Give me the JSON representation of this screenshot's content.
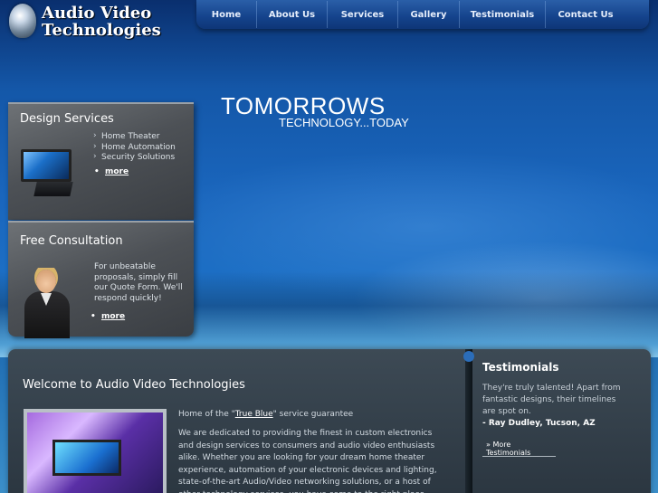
{
  "logo": {
    "line1": "Audio Video",
    "line2": "Technologies"
  },
  "nav": {
    "items": [
      {
        "label": "Home"
      },
      {
        "label": "About Us"
      },
      {
        "label": "Services"
      },
      {
        "label": "Gallery"
      },
      {
        "label": "Testimonials"
      },
      {
        "label": "Contact Us"
      }
    ]
  },
  "hero": {
    "line1": "TOMORROWS",
    "line2": "TECHNOLOGY...TODAY"
  },
  "design_services": {
    "title": "Design Services",
    "items": [
      "Home Theater",
      "Home Automation",
      "Security Solutions"
    ],
    "more": "more"
  },
  "free_consultation": {
    "title": "Free Consultation",
    "text": "For unbeatable proposals, simply fill our Quote Form. We'll respond quickly!",
    "more": "more"
  },
  "welcome": {
    "title": "Welcome to Audio Video Technologies",
    "home_prefix": "Home of the \"",
    "home_link": "True Blue",
    "home_suffix": "\" service guarantee",
    "paragraph": "We are dedicated to providing the finest in custom electronics and design services to consumers and audio video enthusiasts alike. Whether you are looking for your dream home theater experience, automation of your electronic devices and lighting, state-of-the-art Audio/Video networking solutions, or a host of other technology services, you have come to the right place."
  },
  "testimonials": {
    "title": "Testimonials",
    "quote": "They're truly talented! Apart from fantastic designs, their timelines are spot on.",
    "author": "- Ray Dudley, Tucson, AZ",
    "more_label": "» More Testimonials"
  }
}
